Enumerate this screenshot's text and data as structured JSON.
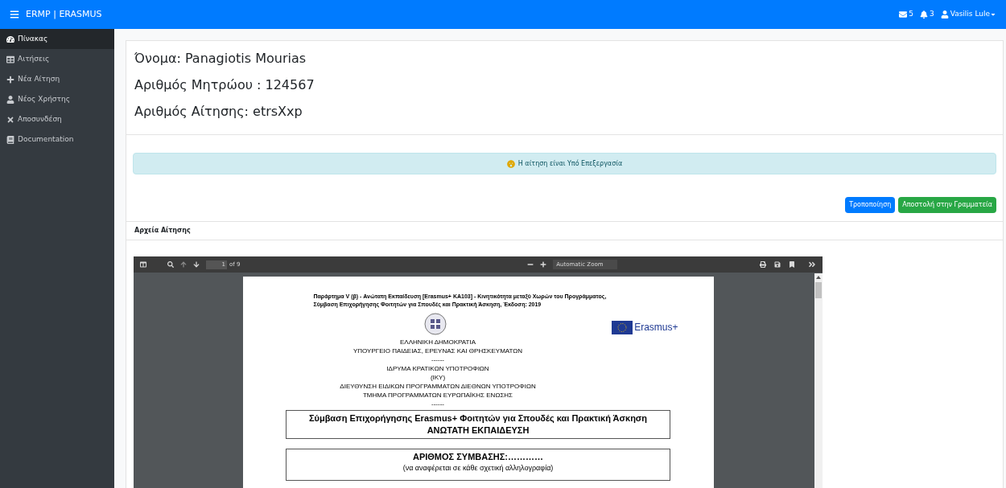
{
  "navbar": {
    "brand": "ERMP | ERASMUS",
    "messages": "5",
    "notifications": "3",
    "user": "Vasilis Lule"
  },
  "sidebar": {
    "items": [
      {
        "label": "Πίνακας",
        "selected": true
      },
      {
        "label": "Αιτήσεις",
        "selected": false
      },
      {
        "label": "Νέα Αίτηση",
        "selected": false
      },
      {
        "label": "Νέος Χρήστης",
        "selected": false
      },
      {
        "label": "Αποσυνδέση",
        "selected": false
      },
      {
        "label": "Documentation",
        "selected": false
      }
    ]
  },
  "student": {
    "name": "Όνομα: Panagiotis Mourias",
    "registry": "Αριθμός Μητρώου : 124567",
    "application": "Αριθμός Αίτησης: etrsXxp"
  },
  "status_alert": "Η αίτηση είναι Υπό Επεξεργασία",
  "buttons": [
    {
      "label": "Τροποποίηση",
      "kind": "primary"
    },
    {
      "label": "Αποστολή στην Γραμματεία",
      "kind": "success"
    }
  ],
  "files": {
    "title": "Αρχεία Αίτησης",
    "viewer": {
      "page": "1",
      "page_count": "of 9",
      "zoom": "Automatic Zoom",
      "document": {
        "header": [
          "Παράρτημα V (β) - Ανώτατη Εκπαίδευση [Erasmus+ KA103] - Κινητικότητα μεταξύ Χωρών του Προγράμματος,",
          "Σύμβαση Επιχορήγησης Φοιτητών για Σπουδές και Πρακτική Άσκηση, Έκδοση: 2019"
        ],
        "logo_text": "Erasmus+",
        "authority": [
          "ΕΛΛΗΝΙΚΗ ΔΗΜΟΚΡΑΤΙΑ",
          "ΥΠΟΥΡΓΕΙΟ ΠΑΙΔΕΙΑΣ, ΕΡΕΥΝΑΣ ΚΑΙ ΘΡΗΣΚΕΥΜΑΤΩΝ",
          "------",
          "ΙΔΡΥΜΑ ΚΡΑΤΙΚΩΝ ΥΠΟΤΡΟΦΙΩΝ",
          "(ΙΚΥ)",
          "ΔΙΕΥΘΥΝΣΗ ΕΙΔΙΚΩΝ ΠΡΟΓΡΑΜΜΑΤΩΝ ΔΙΕΘΝΩΝ ΥΠΟΤΡΟΦΙΩΝ",
          "ΤΜΗΜΑ ΠΡΟΓΡΑΜΜΑΤΩΝ ΕΥΡΩΠΑΪΚΗΣ ΕΝΩΣΗΣ",
          "------"
        ],
        "title_box": [
          "Σύμβαση Επιχορήγησης Erasmus+ Φοιτητών για Σπουδές και Πρακτική Άσκηση",
          "ΑΝΩΤΑΤΗ ΕΚΠΑΙΔΕΥΣΗ"
        ],
        "number_box": [
          "ΑΡΙΘΜΟΣ ΣΥΜΒΑΣΗΣ:…………",
          "(να αναφέρεται σε κάθε σχετική αλληλογραφία)"
        ]
      }
    }
  }
}
